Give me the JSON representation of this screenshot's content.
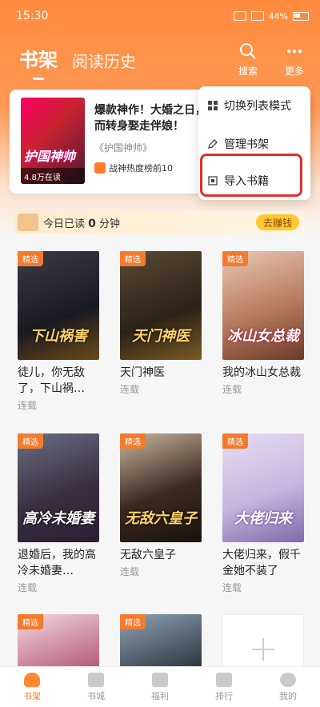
{
  "status": {
    "time": "15:30",
    "battery": "44%"
  },
  "tabs": {
    "active": "书架",
    "other": "阅读历史"
  },
  "actions": {
    "search": "搜索",
    "more": "更多"
  },
  "recent": {
    "cover_title": "护国神帅",
    "reads": "4.8万在读",
    "description": "爆款神作！大婚之日，而转身娶走伴娘！",
    "source": "《护国神帅》",
    "hot": "战神热度榜前10"
  },
  "popup": {
    "switch_mode": "切换列表模式",
    "manage": "管理书架",
    "import": "导入书籍"
  },
  "reading": {
    "label_prefix": "今日已读",
    "minutes": "0",
    "label_suffix": "分钟",
    "earn": "去赚钱"
  },
  "books": [
    {
      "tag": "精选",
      "cover_text": "下山祸害",
      "title": "徒儿，你无敌了，下山祸…",
      "status": "连载"
    },
    {
      "tag": "精选",
      "cover_text": "天门神医",
      "title": "天门神医",
      "status": "连载"
    },
    {
      "tag": "精选",
      "cover_text": "冰山女总裁",
      "title": "我的冰山女总裁",
      "status": "连载"
    },
    {
      "tag": "精选",
      "cover_text": "高冷未婚妻",
      "title": "退婚后，我的高冷未婚妻…",
      "status": "连载"
    },
    {
      "tag": "精选",
      "cover_text": "无敌六皇子",
      "title": "无敌六皇子",
      "status": "连载"
    },
    {
      "tag": "精选",
      "cover_text": "大佬归来",
      "title": "大佬归来，假千金她不装了",
      "status": "连载"
    },
    {
      "tag": "精选",
      "cover_text": "",
      "title": "",
      "status": ""
    },
    {
      "tag": "精选",
      "cover_text": "",
      "title": "",
      "status": ""
    }
  ],
  "nav": [
    "书架",
    "书城",
    "福利",
    "排行",
    "我的"
  ]
}
